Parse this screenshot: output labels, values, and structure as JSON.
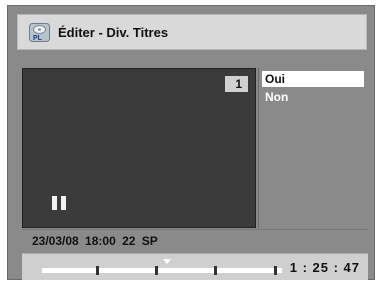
{
  "header": {
    "icon": "disc-pl-icon",
    "icon_label": "PL",
    "title": "Éditer - Div. Titres"
  },
  "preview": {
    "title_number": "1",
    "state_icon": "pause-icon"
  },
  "menu": {
    "options": [
      "Oui",
      "Non"
    ],
    "selected": "Oui"
  },
  "info": {
    "text": "23/03/08  18:00  22  SP"
  },
  "progress": {
    "time": "1 : 25 : 47"
  }
}
